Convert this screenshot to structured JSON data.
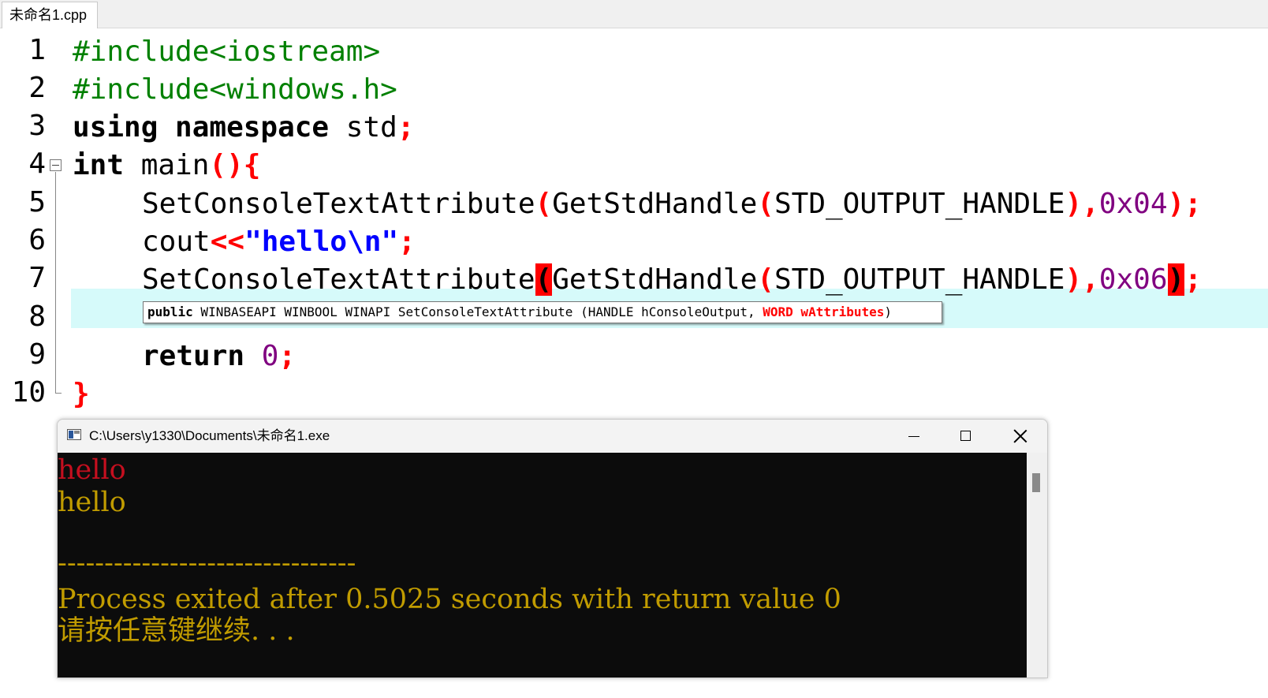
{
  "tab": {
    "label": "未命名1.cpp"
  },
  "editor": {
    "line_numbers": [
      "1",
      "2",
      "3",
      "4",
      "5",
      "6",
      "7",
      "8",
      "9",
      "10"
    ],
    "lines": {
      "l1": "#include<iostream>",
      "l2": "#include<windows.h>",
      "l3_kw": "using namespace",
      "l3_id": " std",
      "l3_semi": ";",
      "l4_kw": "int",
      "l4_id": " main",
      "l4_sym": "(){",
      "l5_fn": "SetConsoleTextAttribute",
      "l5_p1": "(",
      "l5_fn2": "GetStdHandle",
      "l5_p2": "(",
      "l5_arg": "STD_OUTPUT_HANDLE",
      "l5_p3": "),",
      "l5_num": "0x04",
      "l5_end": ");",
      "l6_id": "cout",
      "l6_op": "<<",
      "l6_str": "\"hello\\n\"",
      "l6_semi": ";",
      "l7_fn": "SetConsoleTextAttribute",
      "l7_p1": "(",
      "l7_fn2": "GetStdHandle",
      "l7_p2": "(",
      "l7_arg": "STD_OUTPUT_HANDLE",
      "l7_p3": "),",
      "l7_num": "0x06",
      "l7_p4": ")",
      "l7_semi": ";",
      "l9_kw": "return",
      "l9_num": "0",
      "l9_semi": ";",
      "l10": "}"
    },
    "tooltip": {
      "kw": "public",
      "sig": " WINBASEAPI WINBOOL WINAPI SetConsoleTextAttribute (HANDLE hConsoleOutput, ",
      "current_param": "WORD wAttributes",
      "close": ")"
    }
  },
  "console": {
    "title": "C:\\Users\\y1330\\Documents\\未命名1.exe",
    "output": {
      "line1": "hello",
      "line2": "hello",
      "separator": "--------------------------------",
      "exit_msg": "Process exited after 0.5025 seconds with return value 0",
      "continue_msg": "请按任意键继续. . ."
    },
    "colors": {
      "red": "#c50f1f",
      "yellow": "#c19c00",
      "background": "#0c0c0c"
    }
  },
  "icons": {
    "minimize": "minimize-icon",
    "maximize": "maximize-icon",
    "close": "close-icon",
    "fold": "fold-minus-icon",
    "app": "console-app-icon"
  }
}
